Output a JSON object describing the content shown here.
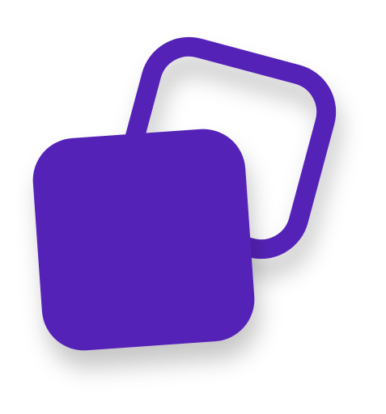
{
  "logo": {
    "name": "rotated-squares-logo",
    "colors": {
      "primary": "#5520b8",
      "background": "#ffffff",
      "shadow": "#000000"
    },
    "icon": "two-overlapping-rounded-squares"
  }
}
